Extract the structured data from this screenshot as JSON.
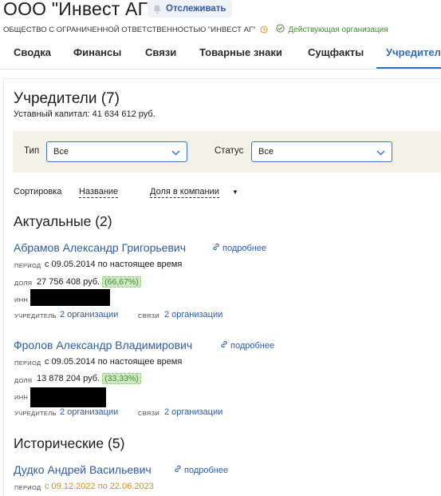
{
  "header": {
    "company_title": "ООО \"Инвест АГ\"",
    "track_label": "Отслеживать",
    "full_name": "ОБЩЕСТВО С ОГРАНИЧЕННОЙ ОТВЕТСТВЕННОСТЬЮ \"ИНВЕСТ АГ\"",
    "status_text": "Действующая организация",
    "status_color": "#3f8a2e"
  },
  "tabs": [
    {
      "label": "Сводка",
      "active": false
    },
    {
      "label": "Финансы",
      "active": false
    },
    {
      "label": "Связи",
      "active": false
    },
    {
      "label": "Товарные знаки",
      "active": false
    },
    {
      "label": "Сущфакты",
      "active": false
    },
    {
      "label": "Учредител",
      "active": true
    }
  ],
  "founders": {
    "title": "Учредители (7)",
    "capital": "Уставный капитал: 41 634 612 руб.",
    "filters": {
      "type_label": "Тип",
      "type_value": "Все",
      "status_label": "Статус",
      "status_value": "Все"
    },
    "sort": {
      "label": "Сортировка",
      "by_name": "Название",
      "by_share": "Доля в компании"
    },
    "labels": {
      "period": "период",
      "share": "доля",
      "inn": "инн",
      "founder": "учредитель",
      "links": "связи",
      "more": "подробнее"
    },
    "actual_title": "Актуальные (2)",
    "historical_title": "Исторические (5)",
    "actual": [
      {
        "name": "Абрамов Александр Григорьевич",
        "period": "с 09.05.2014 по настоящее время",
        "share_amount": "27 756 408 руб.",
        "share_pct": "(66,67%)",
        "founder_orgs": "2 организации",
        "link_orgs": "2 организации"
      },
      {
        "name": "Фролов Александр Владимирович",
        "period": "с 09.05.2014 по настоящее время",
        "share_amount": "13 878 204 руб.",
        "share_pct": "(33,33%)",
        "founder_orgs": "2 организации",
        "link_orgs": "2 организации"
      }
    ],
    "historical": [
      {
        "name": "Дудко Андрей Васильевич",
        "period": "с 09.12.2022 по 22.06.2023"
      }
    ]
  },
  "colors": {
    "accent": "#2f6bc5",
    "link": "#2f5ba7",
    "filter_bg": "#f3f2e8",
    "period_historical": "#d98a1f",
    "pct_bg": "#cfe9c2"
  }
}
